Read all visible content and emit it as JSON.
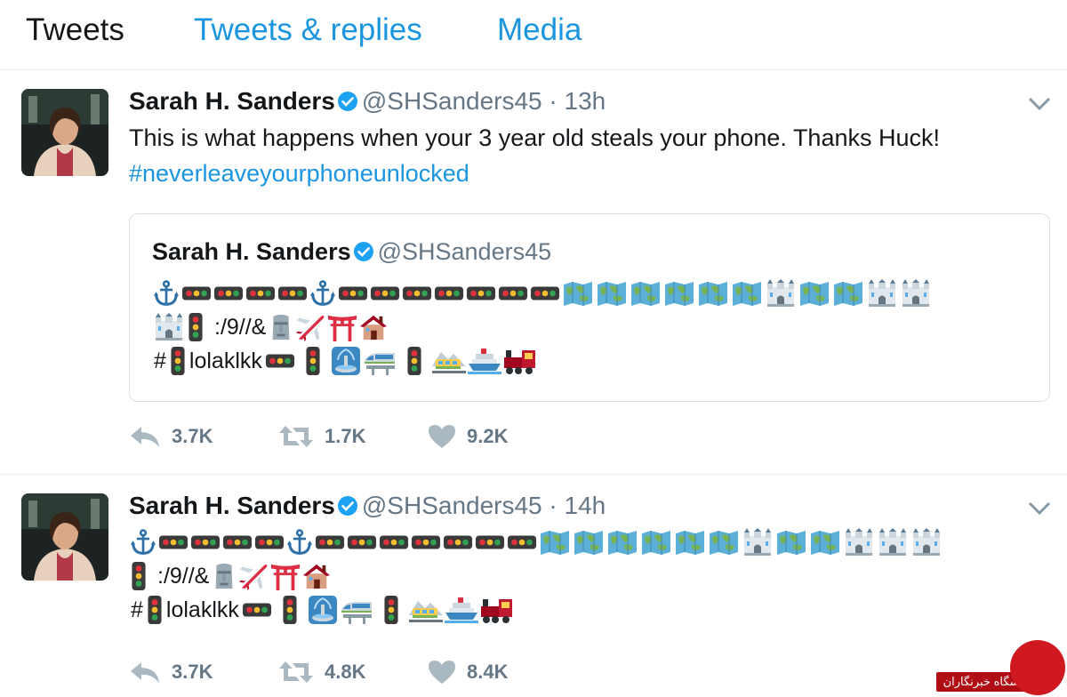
{
  "tabs": [
    {
      "label": "Tweets",
      "active": true
    },
    {
      "label": "Tweets & replies",
      "active": false
    },
    {
      "label": "Media",
      "active": false
    }
  ],
  "tweets": [
    {
      "name": "Sarah H. Sanders",
      "handle": "@SHSanders45",
      "separator": "·",
      "time": "13h",
      "text": "This is what happens when your 3 year old steals your phone. Thanks Huck!",
      "hashtag": "#neverleaveyourphoneunlocked",
      "quote": {
        "name": "Sarah H. Sanders",
        "handle": "@SHSanders45",
        "text_1": ":/9//&",
        "text_2": "#",
        "text_3": "lolaklkk"
      },
      "replies": "3.7K",
      "retweets": "1.7K",
      "likes": "9.2K"
    },
    {
      "name": "Sarah H. Sanders",
      "handle": "@SHSanders45",
      "separator": "·",
      "time": "14h",
      "text_1": ":/9//&",
      "text_2": "#",
      "text_3": "lolaklkk",
      "replies": "3.7K",
      "retweets": "4.8K",
      "likes": "8.4K"
    }
  ],
  "icons": [
    "anchor-icon",
    "horizontal-traffic-light-icon",
    "world-map-icon",
    "castle-icon",
    "vertical-traffic-light-icon",
    "moai-icon",
    "airplane-icon",
    "torii-gate-icon",
    "house-icon",
    "fountain-icon",
    "monorail-icon",
    "mountain-railway-icon",
    "ship-icon",
    "locomotive-icon",
    "verified-badge-icon",
    "caret-down-icon",
    "reply-icon",
    "retweet-icon",
    "heart-icon"
  ],
  "colors": {
    "link": "#1b95e0",
    "muted": "#657786",
    "verified": "#1da1f2",
    "border": "#e6ecf0"
  },
  "watermark": {
    "label": "باشگاه خبرنگاران"
  }
}
